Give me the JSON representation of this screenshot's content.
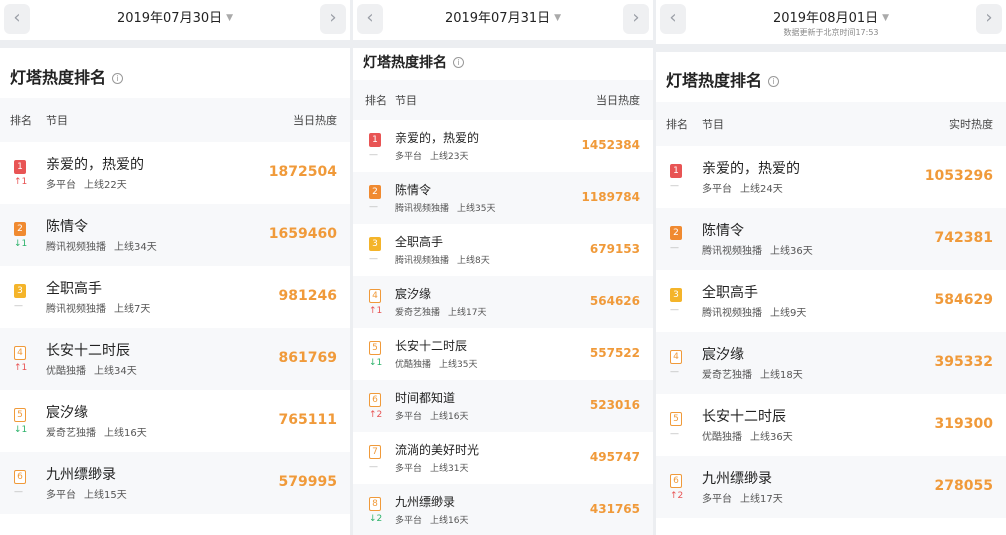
{
  "colors": {
    "rank_1": "#e85454",
    "rank_2": "#f08a30",
    "rank_3": "#f4b42a",
    "rank_other": "#ffffff",
    "value": "#f09a3a",
    "up": "#e85454",
    "down": "#2fb36c",
    "flat": "#b3b3b3"
  },
  "panels": [
    {
      "date": "2019年07月30日",
      "title": "灯塔热度排名",
      "col_rank": "排名",
      "col_show": "节目",
      "col_heat": "当日热度",
      "rows": [
        {
          "rank": "1",
          "change": "↑1",
          "dir": "up",
          "name": "亲爱的，热爱的",
          "platform": "多平台",
          "online": "上线22天",
          "value": "1872504"
        },
        {
          "rank": "2",
          "change": "↓1",
          "dir": "down",
          "name": "陈情令",
          "platform": "腾讯视频独播",
          "online": "上线34天",
          "value": "1659460"
        },
        {
          "rank": "3",
          "change": "—",
          "dir": "flat",
          "name": "全职高手",
          "platform": "腾讯视频独播",
          "online": "上线7天",
          "value": "981246"
        },
        {
          "rank": "4",
          "change": "↑1",
          "dir": "up",
          "name": "长安十二时辰",
          "platform": "优酷独播",
          "online": "上线34天",
          "value": "861769"
        },
        {
          "rank": "5",
          "change": "↓1",
          "dir": "down",
          "name": "宸汐缘",
          "platform": "爱奇艺独播",
          "online": "上线16天",
          "value": "765111"
        },
        {
          "rank": "6",
          "change": "—",
          "dir": "flat",
          "name": "九州缥缈录",
          "platform": "多平台",
          "online": "上线15天",
          "value": "579995"
        }
      ]
    },
    {
      "date": "2019年07月31日",
      "title": "灯塔热度排名",
      "col_rank": "排名",
      "col_show": "节目",
      "col_heat": "当日热度",
      "rows": [
        {
          "rank": "1",
          "change": "—",
          "dir": "flat",
          "name": "亲爱的，热爱的",
          "platform": "多平台",
          "online": "上线23天",
          "value": "1452384"
        },
        {
          "rank": "2",
          "change": "—",
          "dir": "flat",
          "name": "陈情令",
          "platform": "腾讯视频独播",
          "online": "上线35天",
          "value": "1189784"
        },
        {
          "rank": "3",
          "change": "—",
          "dir": "flat",
          "name": "全职高手",
          "platform": "腾讯视频独播",
          "online": "上线8天",
          "value": "679153"
        },
        {
          "rank": "4",
          "change": "↑1",
          "dir": "up",
          "name": "宸汐缘",
          "platform": "爱奇艺独播",
          "online": "上线17天",
          "value": "564626"
        },
        {
          "rank": "5",
          "change": "↓1",
          "dir": "down",
          "name": "长安十二时辰",
          "platform": "优酷独播",
          "online": "上线35天",
          "value": "557522"
        },
        {
          "rank": "6",
          "change": "↑2",
          "dir": "up",
          "name": "时间都知道",
          "platform": "多平台",
          "online": "上线16天",
          "value": "523016"
        },
        {
          "rank": "7",
          "change": "—",
          "dir": "flat",
          "name": "流淌的美好时光",
          "platform": "多平台",
          "online": "上线31天",
          "value": "495747"
        },
        {
          "rank": "8",
          "change": "↓2",
          "dir": "down",
          "name": "九州缥缈录",
          "platform": "多平台",
          "online": "上线16天",
          "value": "431765"
        }
      ]
    },
    {
      "date": "2019年08月01日",
      "subtitle": "数据更新于北京时间17:53",
      "title": "灯塔热度排名",
      "col_rank": "排名",
      "col_show": "节目",
      "col_heat": "实时热度",
      "rows": [
        {
          "rank": "1",
          "change": "—",
          "dir": "flat",
          "name": "亲爱的，热爱的",
          "platform": "多平台",
          "online": "上线24天",
          "value": "1053296"
        },
        {
          "rank": "2",
          "change": "—",
          "dir": "flat",
          "name": "陈情令",
          "platform": "腾讯视频独播",
          "online": "上线36天",
          "value": "742381"
        },
        {
          "rank": "3",
          "change": "—",
          "dir": "flat",
          "name": "全职高手",
          "platform": "腾讯视频独播",
          "online": "上线9天",
          "value": "584629"
        },
        {
          "rank": "4",
          "change": "—",
          "dir": "flat",
          "name": "宸汐缘",
          "platform": "爱奇艺独播",
          "online": "上线18天",
          "value": "395332"
        },
        {
          "rank": "5",
          "change": "—",
          "dir": "flat",
          "name": "长安十二时辰",
          "platform": "优酷独播",
          "online": "上线36天",
          "value": "319300"
        },
        {
          "rank": "6",
          "change": "↑2",
          "dir": "up",
          "name": "九州缥缈录",
          "platform": "多平台",
          "online": "上线17天",
          "value": "278055"
        }
      ]
    }
  ]
}
